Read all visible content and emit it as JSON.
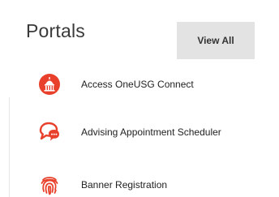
{
  "widget": {
    "title": "Portals",
    "view_all_label": "View All"
  },
  "portals": [
    {
      "label": "Access OneUSG Connect",
      "icon": "capitol-dome-icon"
    },
    {
      "label": "Advising Appointment Scheduler",
      "icon": "chat-bubble-icon"
    },
    {
      "label": "Banner Registration",
      "icon": "fingerprint-icon"
    }
  ],
  "colors": {
    "accent": "#e8402a",
    "button_bg": "#e3e3e3",
    "title_text": "#3a3a3a"
  }
}
